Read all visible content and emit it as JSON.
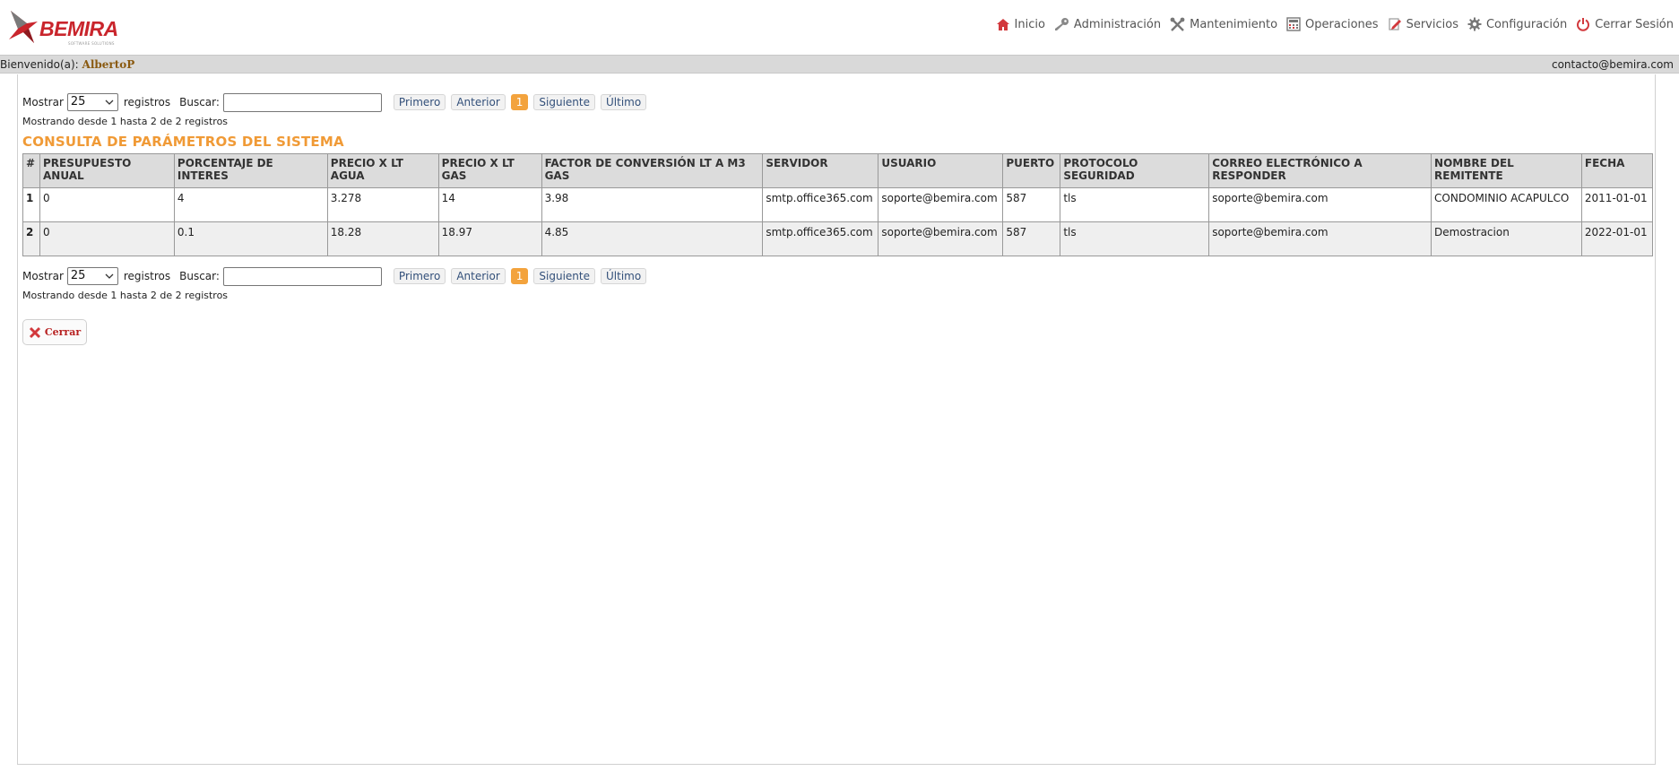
{
  "brand": {
    "logo_text": "BEMIRA",
    "logo_sub": "SOFTWARE SOLUTIONS",
    "colors": {
      "brand_red": "#c9252c",
      "accent_orange": "#f09a36"
    }
  },
  "nav": [
    {
      "label": "Inicio",
      "icon": "home-icon"
    },
    {
      "label": "Administración",
      "icon": "key-icon"
    },
    {
      "label": "Mantenimiento",
      "icon": "tools-icon"
    },
    {
      "label": "Operaciones",
      "icon": "calculator-icon"
    },
    {
      "label": "Servicios",
      "icon": "pencil-icon"
    },
    {
      "label": "Configuración",
      "icon": "gear-icon"
    },
    {
      "label": "Cerrar Sesión",
      "icon": "power-icon"
    }
  ],
  "welcome": {
    "prefix": "Bienvenido(a):",
    "user": "AlbertoP",
    "contact": "contacto@bemira.com"
  },
  "controls": {
    "show_label": "Mostrar",
    "page_size": "25",
    "records_label": "registros",
    "search_label": "Buscar:",
    "search_value": "",
    "first": "Primero",
    "prev": "Anterior",
    "current_page": "1",
    "next": "Siguiente",
    "last": "Último",
    "info": "Mostrando desde 1 hasta 2 de 2 registros"
  },
  "section_title": "CONSULTA DE PARÁMETROS DEL SISTEMA",
  "table": {
    "headers": [
      "#",
      "PRESUPUESTO ANUAL",
      "PORCENTAJE DE INTERES",
      "PRECIO X LT AGUA",
      "PRECIO X LT GAS",
      "FACTOR DE CONVERSIÓN LT A M3 GAS",
      "SERVIDOR",
      "USUARIO",
      "PUERTO",
      "PROTOCOLO SEGURIDAD",
      "CORREO ELECTRÓNICO A RESPONDER",
      "NOMBRE DEL REMITENTE",
      "FECHA"
    ],
    "rows": [
      [
        "1",
        "0",
        "4",
        "3.278",
        "14",
        "3.98",
        "smtp.office365.com",
        "soporte@bemira.com",
        "587",
        "tls",
        "soporte@bemira.com",
        "CONDOMINIO ACAPULCO",
        "2011-01-01"
      ],
      [
        "2",
        "0",
        "0.1",
        "18.28",
        "18.97",
        "4.85",
        "smtp.office365.com",
        "soporte@bemira.com",
        "587",
        "tls",
        "soporte@bemira.com",
        "Demostracion",
        "2022-01-01"
      ]
    ]
  },
  "close_button": {
    "label": "Cerrar",
    "icon": "close-x-icon"
  }
}
